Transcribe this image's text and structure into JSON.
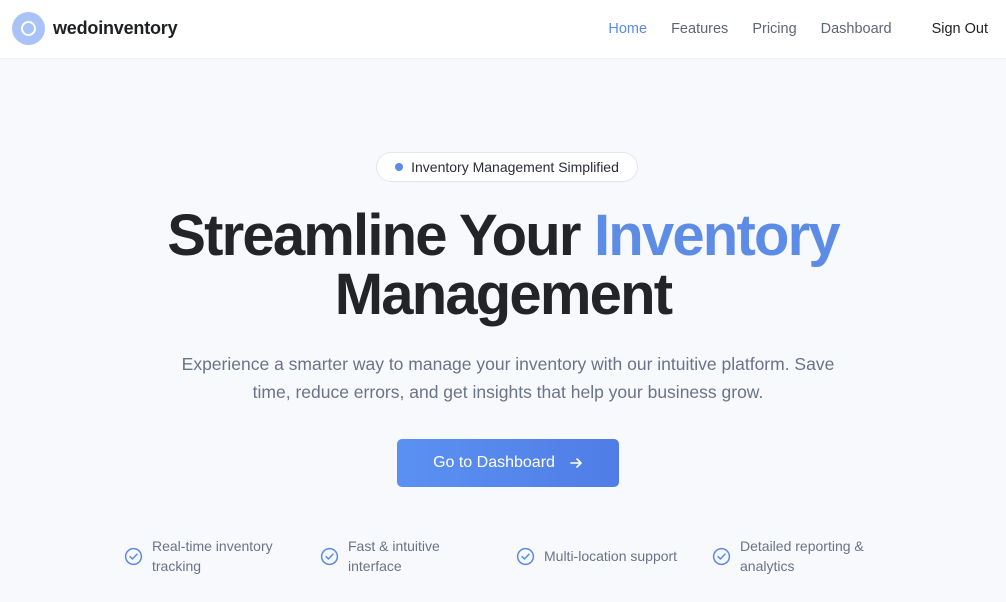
{
  "brand": {
    "name": "wedoinventory",
    "logo_icon": "circle-logo-icon",
    "logo_color": "#a9c2f7"
  },
  "nav": {
    "items": [
      {
        "label": "Home",
        "active": true
      },
      {
        "label": "Features",
        "active": false
      },
      {
        "label": "Pricing",
        "active": false
      },
      {
        "label": "Dashboard",
        "active": false
      }
    ],
    "sign_out": "Sign Out"
  },
  "hero": {
    "badge": "Inventory Management Simplified",
    "headline_part1": "Streamline Your ",
    "headline_accent": "Inventory",
    "headline_part2": "Management",
    "subtitle": "Experience a smarter way to manage your inventory with our intuitive platform. Save time, reduce errors, and get insights that help your business grow.",
    "cta_label": "Go to Dashboard",
    "cta_icon": "arrow-right-icon"
  },
  "features": [
    {
      "label": "Real-time inventory tracking",
      "icon": "check-circle-icon"
    },
    {
      "label": "Fast & intuitive interface",
      "icon": "check-circle-icon"
    },
    {
      "label": "Multi-location support",
      "icon": "check-circle-icon"
    },
    {
      "label": "Detailed reporting & analytics",
      "icon": "check-circle-icon"
    }
  ],
  "colors": {
    "accent": "#5a8be8",
    "background": "#f8f9fc",
    "text_dark": "#232428",
    "text_muted": "#697389"
  }
}
